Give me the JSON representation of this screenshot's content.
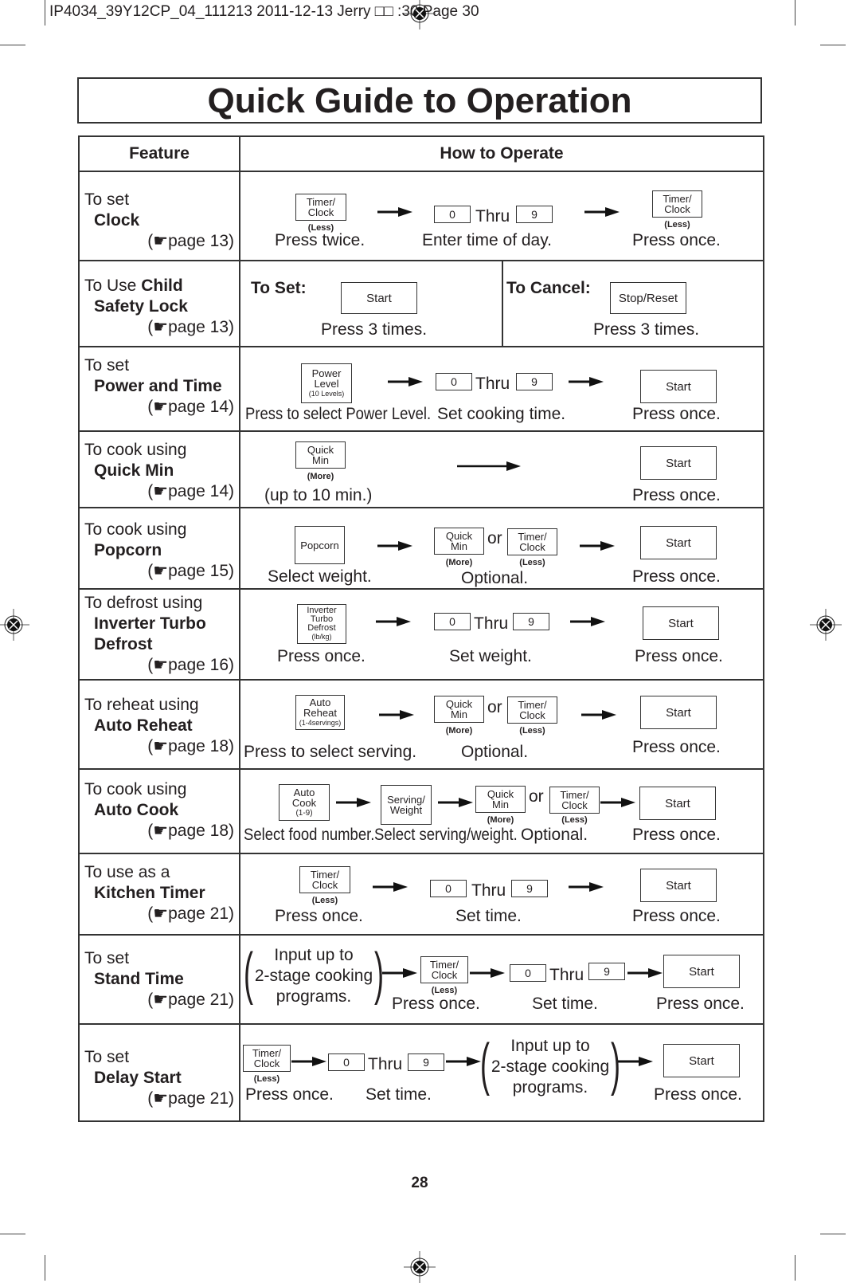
{
  "header": {
    "slug": "IP4034_39Y12CP_04_111213  2011-12-13  Jerry □□ :30  Page 30"
  },
  "title": "Quick Guide to Operation",
  "columns": {
    "feature": "Feature",
    "how": "How to Operate"
  },
  "page_ref_icon": "☛",
  "keys": {
    "timer_clock": "Timer/ Clock",
    "less": "(Less)",
    "more": "(More)",
    "zero": "0",
    "nine": "9",
    "thru": "Thru",
    "or": "or",
    "start": "Start",
    "stop_reset": "Stop/Reset",
    "power_level": "Power Level",
    "power_levels_sub": "(10 Levels)",
    "quick_min": "Quick Min",
    "popcorn": "Popcorn",
    "inverter_defrost": "Inverter Turbo Defrost",
    "inverter_sub": "(lb/kg)",
    "auto_reheat": "Auto Reheat",
    "auto_reheat_sub": "(1-4servings)",
    "auto_cook": "Auto Cook",
    "auto_cook_sub": "(1-9)",
    "serving_weight": "Serving/ Weight"
  },
  "rows": [
    {
      "l1": "To set",
      "l2": "Clock",
      "ref": "page 13)",
      "caps": [
        "Press twice.",
        "Enter time of day.",
        "Press once."
      ]
    },
    {
      "l1": "To Use",
      "l1b": "Child",
      "l2": "Safety Lock",
      "ref": "page 13)",
      "to_set": "To Set:",
      "to_cancel": "To Cancel:",
      "caps": [
        "Press 3 times.",
        "Press 3 times."
      ]
    },
    {
      "l1": "To set",
      "l2": "Power and Time",
      "ref": "page 14)",
      "caps": [
        "Press to select Power Level.",
        "Set cooking time.",
        "Press once."
      ]
    },
    {
      "l1": "To cook using",
      "l2": "Quick Min",
      "ref": "page 14)",
      "caps": [
        "(up to 10 min.)",
        "Press once."
      ]
    },
    {
      "l1": "To cook using",
      "l2": "Popcorn",
      "ref": "page 15)",
      "caps": [
        "Select weight.",
        "Optional.",
        "Press once."
      ]
    },
    {
      "l1": "To defrost using",
      "l2": "Inverter Turbo",
      "l3": "Defrost",
      "ref": "page 16)",
      "caps": [
        "Press once.",
        "Set weight.",
        "Press once."
      ]
    },
    {
      "l1": "To reheat using",
      "l2": "Auto Reheat",
      "ref": "page 18)",
      "caps": [
        "Press to select serving.",
        "Optional.",
        "Press once."
      ]
    },
    {
      "l1": "To cook using",
      "l2": "Auto Cook",
      "ref": "page 18)",
      "caps": [
        "Select food number.",
        "Select serving/weight.",
        "Optional.",
        "Press once."
      ]
    },
    {
      "l1": "To use as a",
      "l2": "Kitchen Timer",
      "ref": "page 21)",
      "caps": [
        "Press once.",
        "Set time.",
        "Press once."
      ]
    },
    {
      "l1": "To set",
      "l2": "Stand Time",
      "ref": "page 21)",
      "paren": [
        "Input up to",
        "2-stage cooking",
        "programs."
      ],
      "caps": [
        "Press once.",
        "Set time.",
        "Press once."
      ]
    },
    {
      "l1": "To set",
      "l2": "Delay Start",
      "ref": "page 21)",
      "paren": [
        "Input up to",
        "2-stage cooking",
        "programs."
      ],
      "caps": [
        "Press once.",
        "Set time.",
        "Press once."
      ]
    }
  ],
  "page_number": "28"
}
